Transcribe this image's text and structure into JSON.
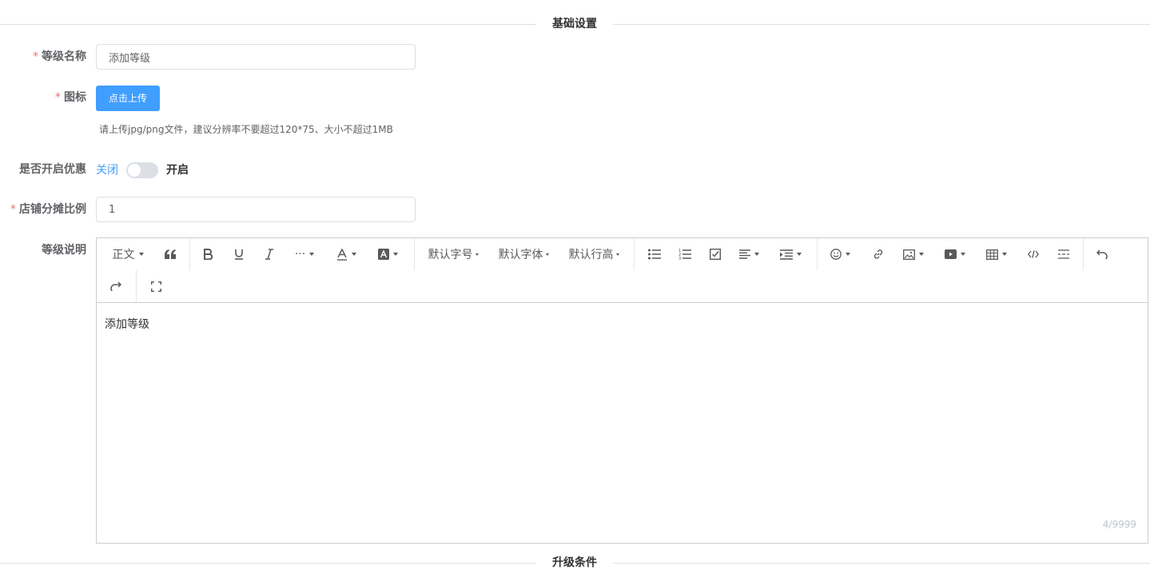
{
  "section_basic": {
    "title": "基础设置"
  },
  "section_upgrade": {
    "title": "升级条件"
  },
  "form": {
    "level_name": {
      "label": "等级名称",
      "required": "*",
      "value": "添加等级"
    },
    "icon": {
      "label": "图标",
      "required": "*",
      "upload_label": "点击上传",
      "hint": "请上传jpg/png文件，建议分辨率不要超过120*75、大小不超过1MB"
    },
    "discount": {
      "label": "是否开启优惠",
      "off_label": "关闭",
      "on_label": "开启",
      "enabled": false
    },
    "ratio": {
      "label": "店铺分摊比例",
      "required": "*",
      "value": "1"
    },
    "description": {
      "label": "等级说明",
      "content": "添加等级",
      "counter": "4/9999"
    }
  },
  "toolbar": {
    "paragraph": "正文",
    "font_size": "默认字号",
    "font_family": "默认字体",
    "line_height": "默认行高",
    "more": "···"
  },
  "icons": {
    "quote": "quote-icon",
    "bold": "bold-icon",
    "underline": "underline-icon",
    "italic": "italic-icon",
    "font_color": "font-color-icon",
    "bg_color": "bg-color-icon",
    "bulleted_list": "bulleted-list-icon",
    "numbered_list": "numbered-list-icon",
    "todo": "todo-icon",
    "align": "align-icon",
    "indent": "indent-icon",
    "emoji": "emoji-icon",
    "link": "link-icon",
    "image": "image-icon",
    "video": "video-icon",
    "table": "table-icon",
    "code": "code-icon",
    "divider": "divider-icon",
    "undo": "undo-icon",
    "redo": "redo-icon",
    "fullscreen": "fullscreen-icon"
  },
  "colors": {
    "primary": "#409eff",
    "required": "#f56c6c",
    "border": "#dcdfe6"
  }
}
